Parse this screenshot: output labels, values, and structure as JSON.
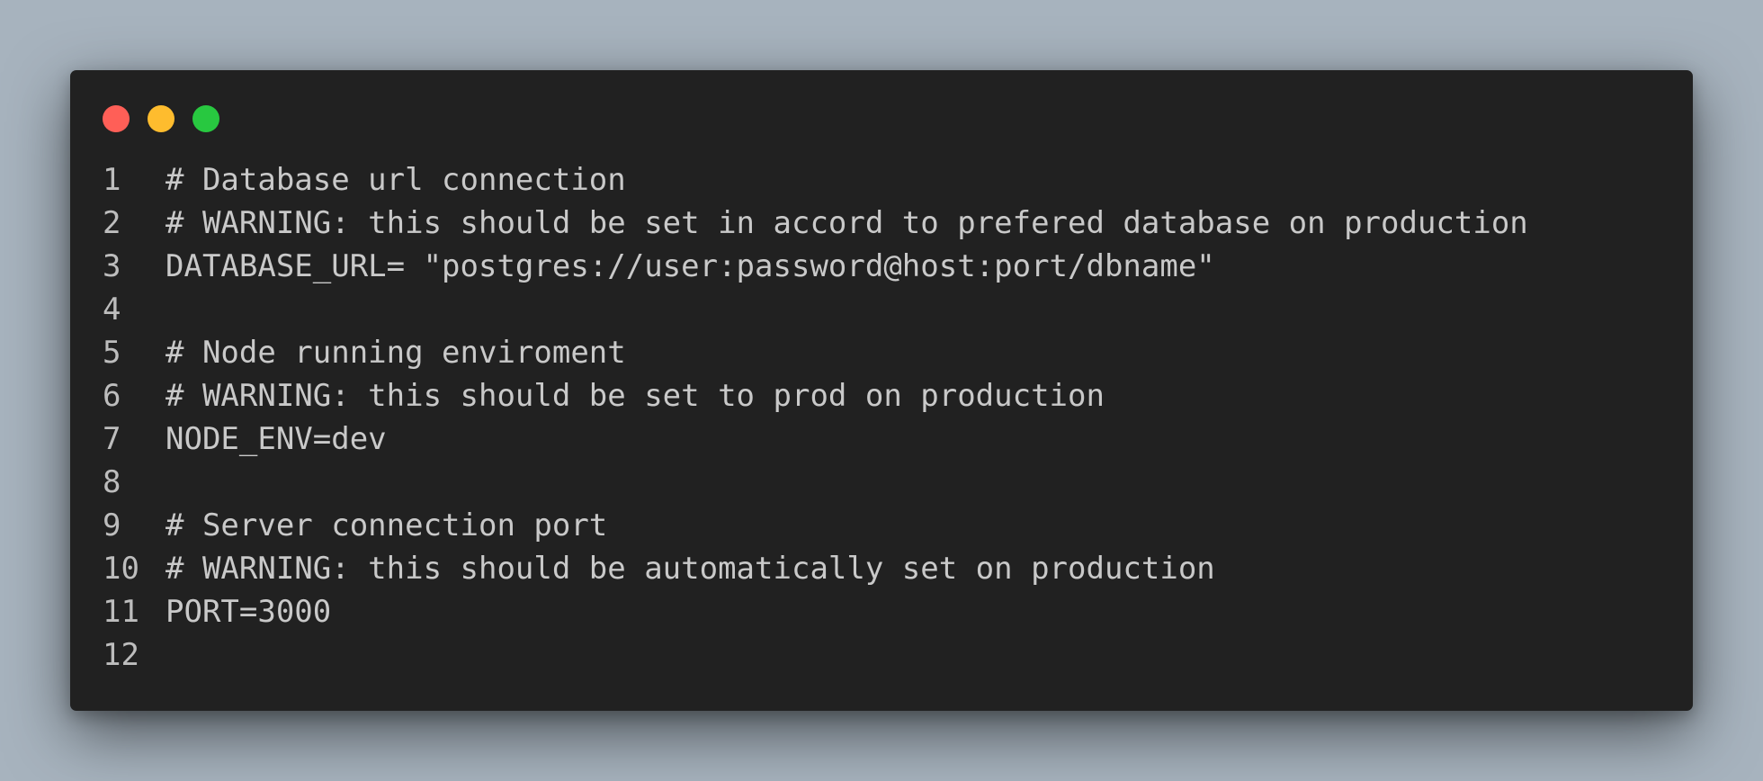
{
  "window": {
    "buttons": {
      "close_color": "#ff5f57",
      "minimize_color": "#febc2e",
      "maximize_color": "#28c840"
    }
  },
  "code": {
    "lines": [
      {
        "number": "1",
        "text": "# Database url connection"
      },
      {
        "number": "2",
        "text": "# WARNING: this should be set in accord to prefered database on production"
      },
      {
        "number": "3",
        "text": "DATABASE_URL= \"postgres://user:password@host:port/dbname\""
      },
      {
        "number": "4",
        "text": ""
      },
      {
        "number": "5",
        "text": "# Node running enviroment"
      },
      {
        "number": "6",
        "text": "# WARNING: this should be set to prod on production"
      },
      {
        "number": "7",
        "text": "NODE_ENV=dev"
      },
      {
        "number": "8",
        "text": ""
      },
      {
        "number": "9",
        "text": "# Server connection port"
      },
      {
        "number": "10",
        "text": "# WARNING: this should be automatically set on production"
      },
      {
        "number": "11",
        "text": "PORT=3000"
      },
      {
        "number": "12",
        "text": ""
      }
    ]
  }
}
